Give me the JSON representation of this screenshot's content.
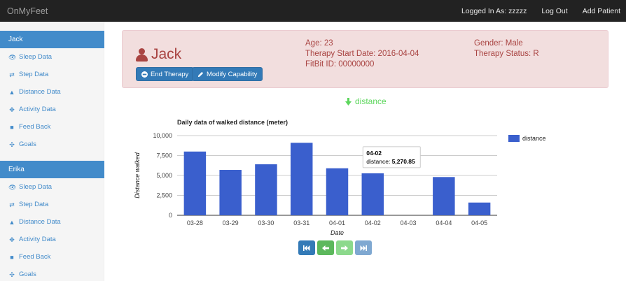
{
  "app": {
    "title": "OnMyFeet"
  },
  "nav": {
    "logged_in": "Logged In As: zzzzz",
    "logout": "Log Out",
    "add_patient": "Add Patient"
  },
  "sidebar": {
    "patients": [
      {
        "name": "Jack",
        "items": [
          "Sleep Data",
          "Step Data",
          "Distance Data",
          "Activity Data",
          "Feed Back",
          "Goals"
        ]
      },
      {
        "name": "Erika",
        "items": [
          "Sleep Data",
          "Step Data",
          "Distance Data",
          "Activity Data",
          "Feed Back",
          "Goals"
        ]
      }
    ]
  },
  "patient": {
    "name": "Jack",
    "age": "Age: 23",
    "therapy_start": "Therapy Start Date: 2016-04-04",
    "fitbit_id": "FitBit ID: 00000000",
    "gender": "Gender: Male",
    "therapy_status": "Therapy Status: R",
    "end_therapy": "End Therapy",
    "modify_capability": "Modify Capability"
  },
  "metric": {
    "label": "distance",
    "color": "#5cd65c"
  },
  "colors": {
    "bar": "#3a5fcd",
    "panel_text": "#a94442",
    "accent": "#428bca"
  },
  "chart_data": {
    "type": "bar",
    "title": "Daily data of walked distance (meter)",
    "xlabel": "Date",
    "ylabel": "Distance walked",
    "categories": [
      "03-28",
      "03-29",
      "03-30",
      "03-31",
      "04-01",
      "04-02",
      "04-03",
      "04-04",
      "04-05"
    ],
    "series": [
      {
        "name": "distance",
        "values": [
          8000,
          5700,
          6400,
          9100,
          5900,
          5270.85,
          0,
          4800,
          1600
        ]
      }
    ],
    "ylim": [
      0,
      10000
    ],
    "yticks": [
      0,
      2500,
      5000,
      7500,
      10000
    ],
    "ytick_labels": [
      "0",
      "2,500",
      "5,000",
      "7,500",
      "10,000"
    ],
    "legend_position": "right",
    "grid": true,
    "tooltip": {
      "category": "04-02",
      "series": "distance",
      "value_label": "5,270.85"
    }
  },
  "pager": {
    "buttons": [
      {
        "name": "first-page",
        "color": "#337ab7"
      },
      {
        "name": "previous-page",
        "color": "#5cb85c"
      },
      {
        "name": "next-page",
        "color": "#8cd98c"
      },
      {
        "name": "last-page",
        "color": "#7fa8d1"
      }
    ]
  }
}
